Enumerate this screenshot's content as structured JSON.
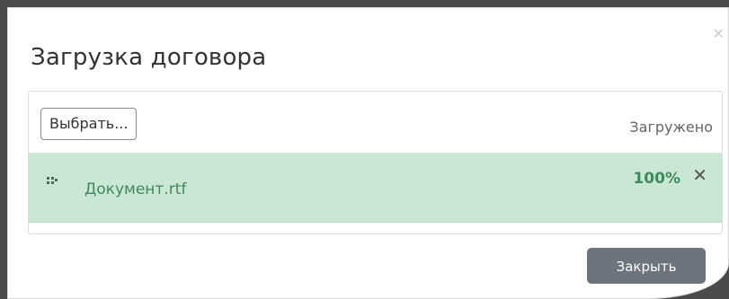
{
  "dialog": {
    "title": "Загрузка договора",
    "close_icon": "close-icon",
    "close_glyph": "×"
  },
  "uploader": {
    "choose_label": "Выбрать...",
    "uploaded_column_label": "Загружено",
    "files": [
      {
        "name": "Документ.rtf",
        "progress_text": "100%",
        "progress": 1.0,
        "remove_glyph": "✕",
        "status_color": "#c9e7d3"
      }
    ]
  },
  "footer": {
    "close_button_label": "Закрыть"
  },
  "colors": {
    "success_text": "#3d8a5c",
    "success_bg": "#c9e7d3",
    "button_bg": "#6c757d"
  }
}
